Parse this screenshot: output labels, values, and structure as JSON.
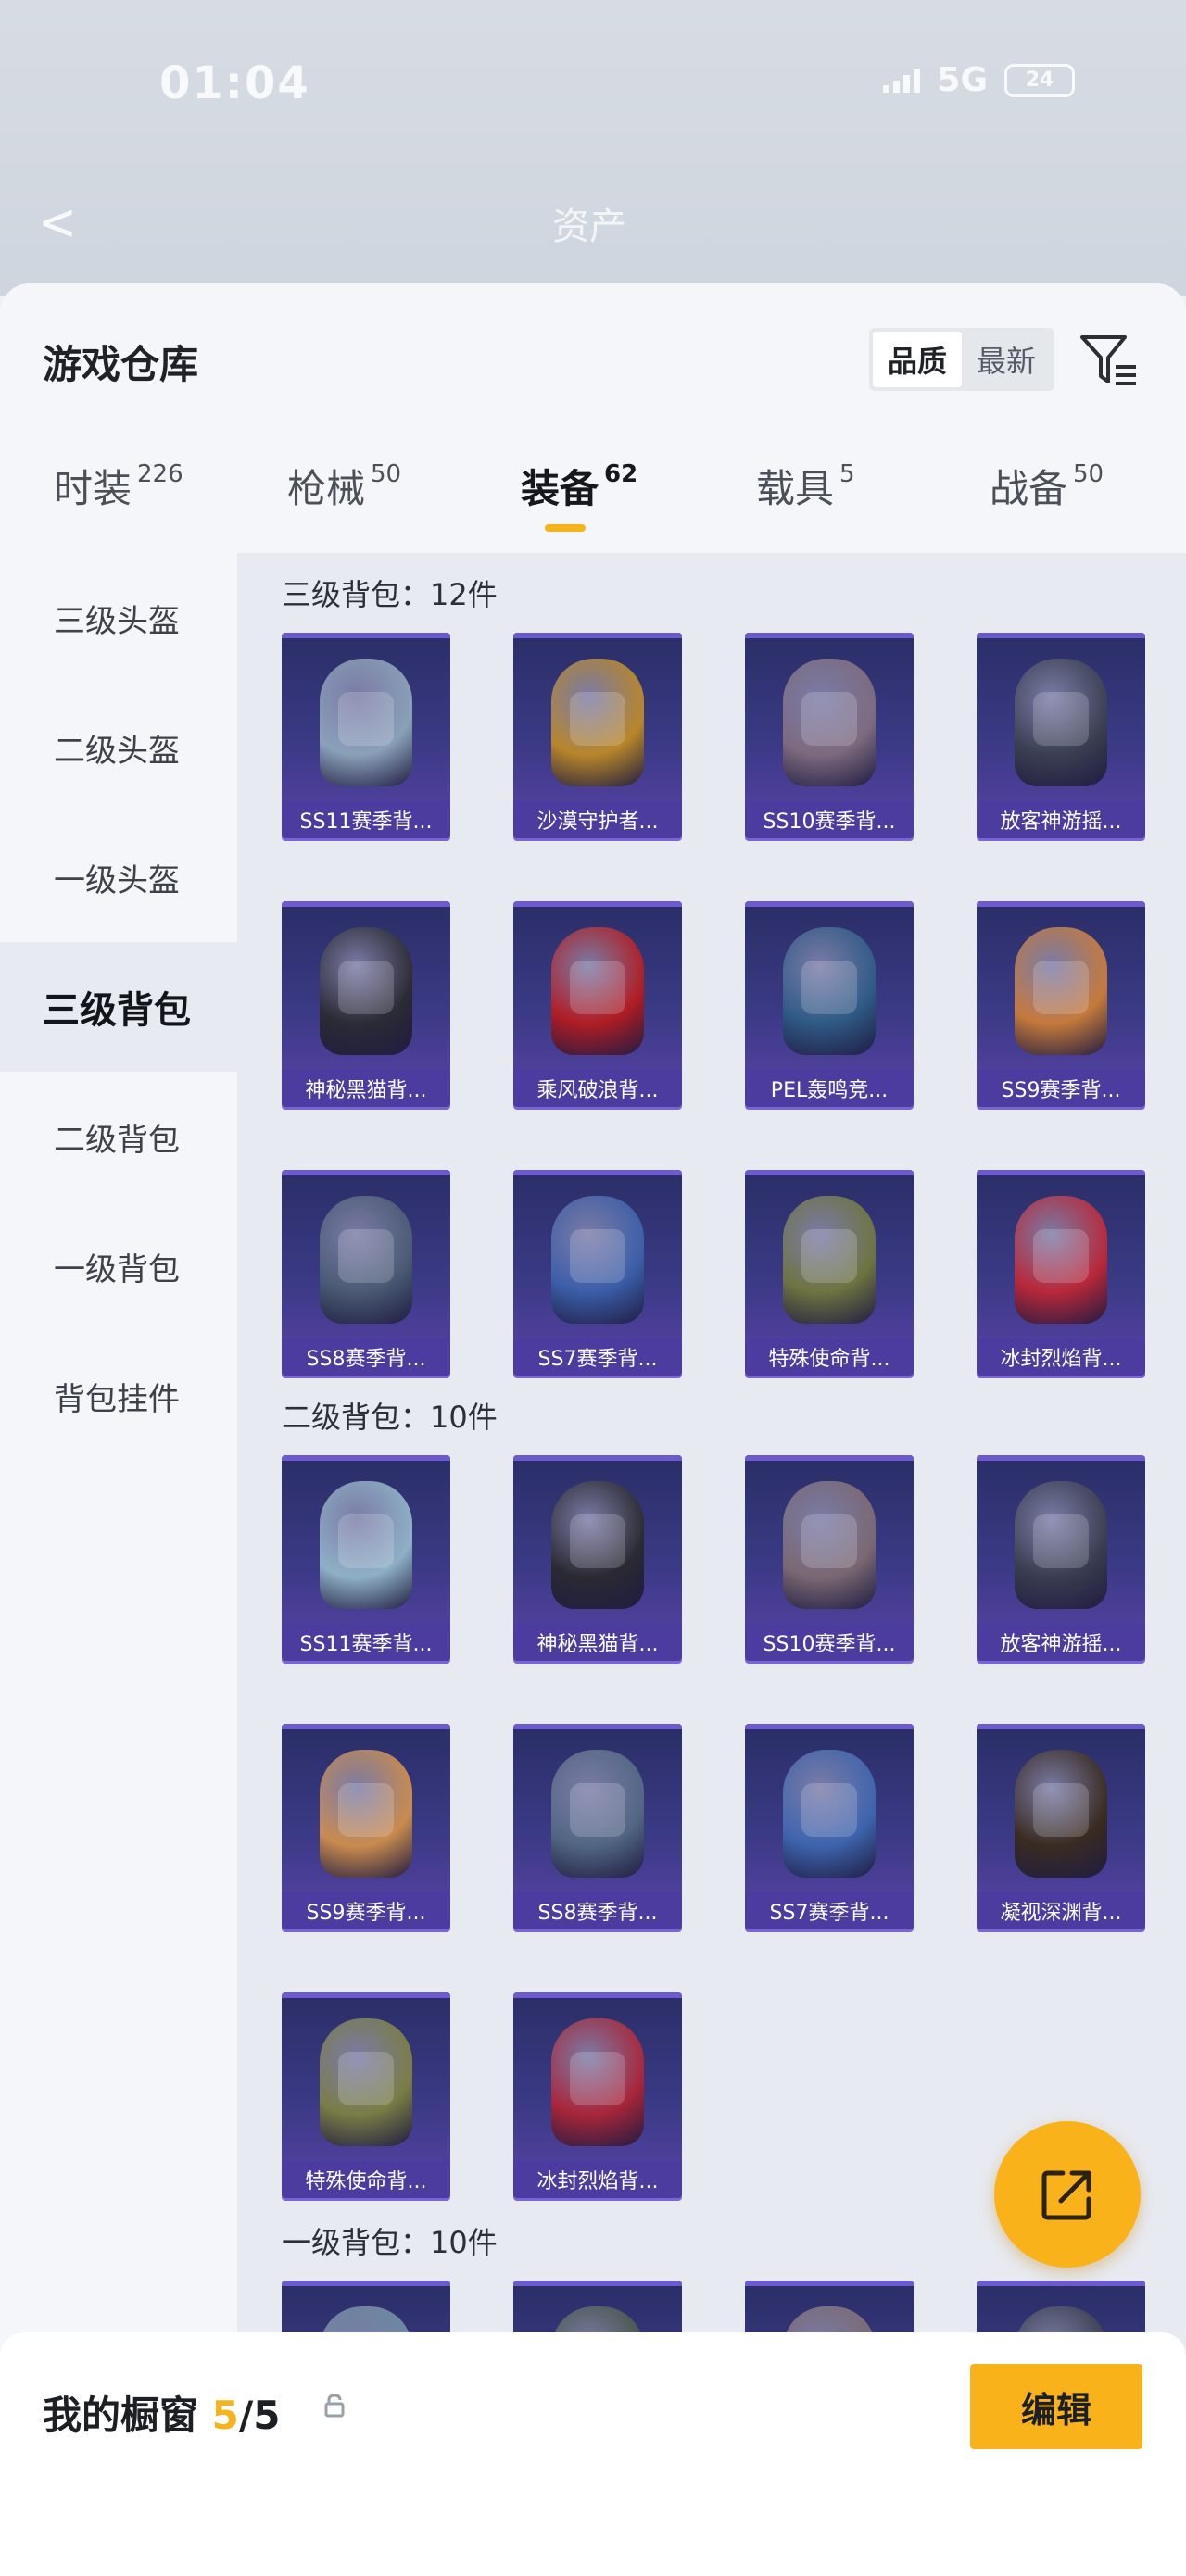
{
  "status": {
    "time": "01:04",
    "network": "5G",
    "battery": "24"
  },
  "nav": {
    "back_icon": "chevron-left-icon",
    "title": "资产"
  },
  "sheet": {
    "title": "游戏仓库",
    "sort": {
      "quality": "品质",
      "newest": "最新",
      "selected": "品质"
    },
    "filter_icon": "filter-list-icon"
  },
  "tabs": [
    {
      "label": "时装",
      "count": "226"
    },
    {
      "label": "枪械",
      "count": "50"
    },
    {
      "label": "装备",
      "count": "62",
      "active": true
    },
    {
      "label": "载具",
      "count": "5"
    },
    {
      "label": "战备",
      "count": "50"
    }
  ],
  "sidebar": {
    "items": [
      {
        "label": "三级头盔"
      },
      {
        "label": "二级头盔"
      },
      {
        "label": "一级头盔"
      },
      {
        "label": "三级背包",
        "active": true
      },
      {
        "label": "二级背包"
      },
      {
        "label": "一级背包"
      },
      {
        "label": "背包挂件"
      }
    ]
  },
  "sections": [
    {
      "title": "三级背包：12件",
      "items": [
        {
          "name": "SS11赛季背...",
          "color": "#8aa0b8"
        },
        {
          "name": "沙漠守护者...",
          "color": "#b8862a"
        },
        {
          "name": "SS10赛季背...",
          "color": "#7d6a7e"
        },
        {
          "name": "放客神游摇...",
          "color": "#3b3f52"
        },
        {
          "name": "神秘黑猫背...",
          "color": "#2c2b35"
        },
        {
          "name": "乘风破浪背...",
          "color": "#b01d24"
        },
        {
          "name": "PEL轰鸣竞...",
          "color": "#2f5a86"
        },
        {
          "name": "SS9赛季背...",
          "color": "#c57a3c"
        },
        {
          "name": "SS8赛季背...",
          "color": "#4a5a74"
        },
        {
          "name": "SS7赛季背...",
          "color": "#3b5ea8"
        },
        {
          "name": "特殊使命背...",
          "color": "#6e7440"
        },
        {
          "name": "冰封烈焰背...",
          "color": "#b8283a"
        }
      ]
    },
    {
      "title": "二级背包：10件",
      "items": [
        {
          "name": "SS11赛季背...",
          "color": "#8eb0c6"
        },
        {
          "name": "神秘黑猫背...",
          "color": "#2b2a32"
        },
        {
          "name": "SS10赛季背...",
          "color": "#7a6873"
        },
        {
          "name": "放客神游摇...",
          "color": "#3a3d50"
        },
        {
          "name": "SS9赛季背...",
          "color": "#c98b4e"
        },
        {
          "name": "SS8赛季背...",
          "color": "#526683"
        },
        {
          "name": "SS7赛季背...",
          "color": "#3e64ad"
        },
        {
          "name": "凝视深渊背...",
          "color": "#3a2c22"
        },
        {
          "name": "特殊使命背...",
          "color": "#7a7d45"
        },
        {
          "name": "冰封烈焰背...",
          "color": "#a8263a"
        }
      ]
    },
    {
      "title": "一级背包：10件",
      "items": [
        {
          "name": "",
          "color": "#6b8aa0"
        },
        {
          "name": "",
          "color": "#48564a"
        },
        {
          "name": "",
          "color": "#7b6a72"
        },
        {
          "name": "",
          "color": "#3c3f4f"
        }
      ]
    }
  ],
  "showcase": {
    "label": "我的橱窗",
    "current": "5",
    "total": "/5",
    "lock_icon": "lock-icon",
    "edit_label": "编辑"
  },
  "fab": {
    "icon": "share-icon"
  },
  "colors": {
    "accent": "#fab21b",
    "card_bg": "#3b3a86",
    "card_label_bg": "#4d3ca0"
  }
}
